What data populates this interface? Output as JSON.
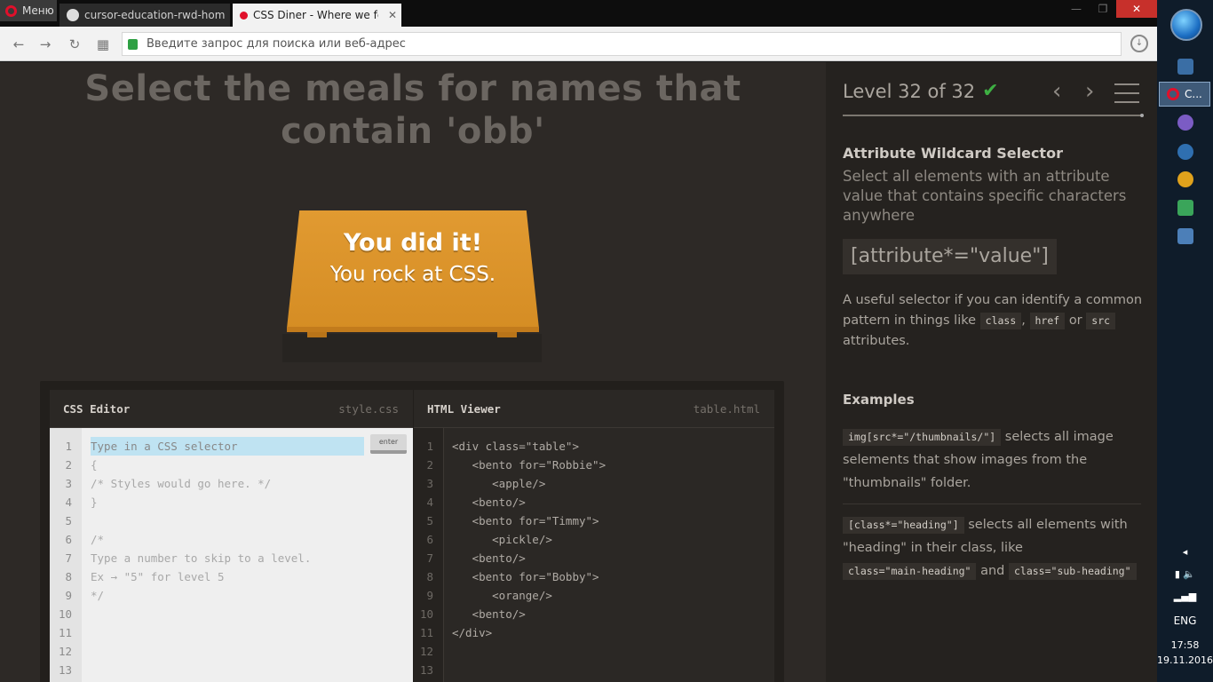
{
  "browser": {
    "menu_label": "Меню",
    "tabs": [
      {
        "label": "cursor-education-rwd-hom"
      },
      {
        "label": "CSS Diner - Where we feas"
      }
    ],
    "address_placeholder": "Введите запрос для поиска или веб-адрес"
  },
  "game": {
    "order": "Select the meals for names that contain 'obb'",
    "win_title": "You did it!",
    "win_subtitle": "You rock at CSS.",
    "css_editor": {
      "title": "CSS Editor",
      "file": "style.css",
      "input_placeholder": "Type in a CSS selector",
      "enter_label": "enter",
      "line_numbers": [
        "1",
        "2",
        "3",
        "4",
        "5",
        "6",
        "7",
        "8",
        "9",
        "10",
        "11",
        "12",
        "13"
      ],
      "lines": [
        "",
        "{",
        "/* Styles would go here. */",
        "}",
        "",
        "/*",
        "Type a number to skip to a level.",
        "Ex → \"5\" for level 5",
        "*/"
      ]
    },
    "html_viewer": {
      "title": "HTML Viewer",
      "file": "table.html",
      "line_numbers": [
        "1",
        "2",
        "3",
        "4",
        "5",
        "6",
        "7",
        "8",
        "9",
        "10",
        "11",
        "12",
        "13"
      ],
      "lines": [
        "<div class=\"table\">",
        "   <bento for=\"Robbie\">",
        "      <apple/>",
        "   <bento/>",
        "   <bento for=\"Timmy\">",
        "      <pickle/>",
        "   <bento/>",
        "   <bento for=\"Bobby\">",
        "      <orange/>",
        "   <bento/>",
        "</div>"
      ]
    }
  },
  "sidebar": {
    "level_title": "Level 32 of 32",
    "check": "✔",
    "prev": "‹",
    "next": "›",
    "selector_name": "Attribute Wildcard Selector",
    "selector_title": "Select all elements with an attribute value that contains specific characters anywhere",
    "syntax": "[attribute*=\"value\"]",
    "hint_pre": "A useful selector if you can identify a common pattern in things like",
    "hint_class": "class",
    "hint_comma": ",",
    "hint_href": "href",
    "hint_or": "or",
    "hint_src": "src",
    "hint_post": "attributes.",
    "examples_heading": "Examples",
    "example1_code": "img[src*=\"/thumbnails/\"]",
    "example1_text": "selects all image selements that show images from the \"thumbnails\" folder.",
    "example2_code": "[class*=\"heading\"]",
    "example2_text": "selects all elements with \"heading\" in their class, like",
    "example2_code2": "class=\"main-heading\"",
    "example2_and": "and",
    "example2_code3": "class=\"sub-heading\""
  },
  "taskbar": {
    "active_label": "C...",
    "lang": "ENG",
    "time": "17:58",
    "date": "19.11.2016"
  }
}
